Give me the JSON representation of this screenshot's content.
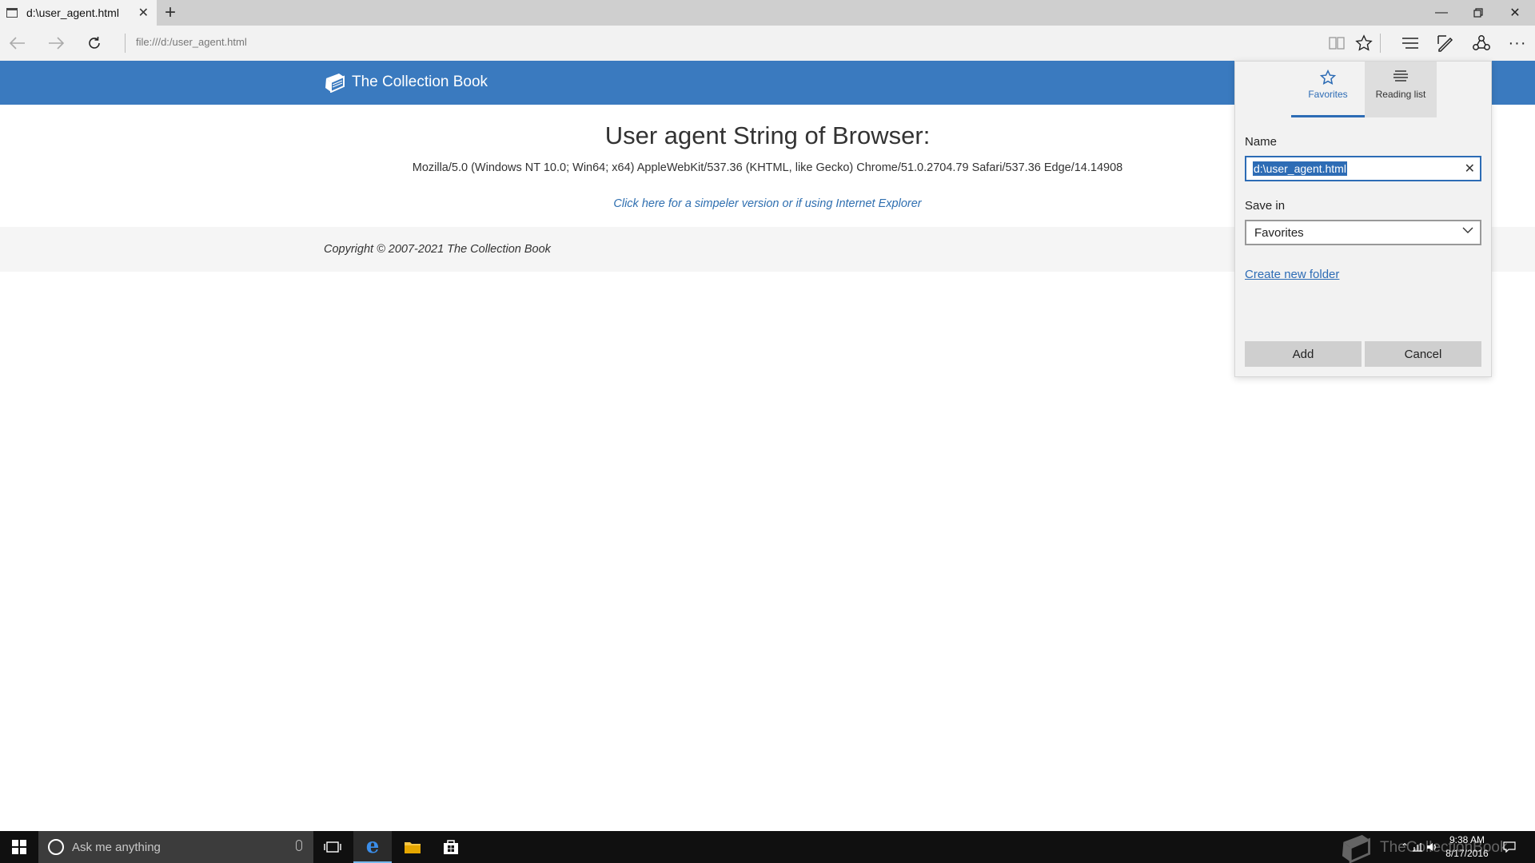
{
  "browser": {
    "tab_title": "d:\\user_agent.html",
    "address": "file:///d:/user_agent.html"
  },
  "site": {
    "brand": "The Collection Book",
    "heading": "User agent String of Browser:",
    "user_agent": "Mozilla/5.0 (Windows NT 10.0; Win64; x64) AppleWebKit/537.36 (KHTML, like Gecko) Chrome/51.0.2704.79 Safari/537.36 Edge/14.14908",
    "simple_link": "Click here for a simpeler version or if using Internet Explorer",
    "copyright": "Copyright © 2007-2021 The Collection Book"
  },
  "flyout": {
    "tabs": [
      {
        "label": "Favorites",
        "icon": "star-icon"
      },
      {
        "label": "Reading list",
        "icon": "reading-list-icon"
      }
    ],
    "name_label": "Name",
    "name_value": "d:\\user_agent.html",
    "save_in_label": "Save in",
    "save_in_value": "Favorites",
    "create_folder_link": "Create new folder",
    "add_label": "Add",
    "cancel_label": "Cancel"
  },
  "taskbar": {
    "search_placeholder": "Ask me anything",
    "time": "9:38 AM",
    "date": "8/17/2016",
    "watermark": "TheCollectionBook"
  },
  "colors": {
    "header_blue": "#3a7abf",
    "accent_blue": "#2d6cb5",
    "taskbar": "#101010"
  }
}
